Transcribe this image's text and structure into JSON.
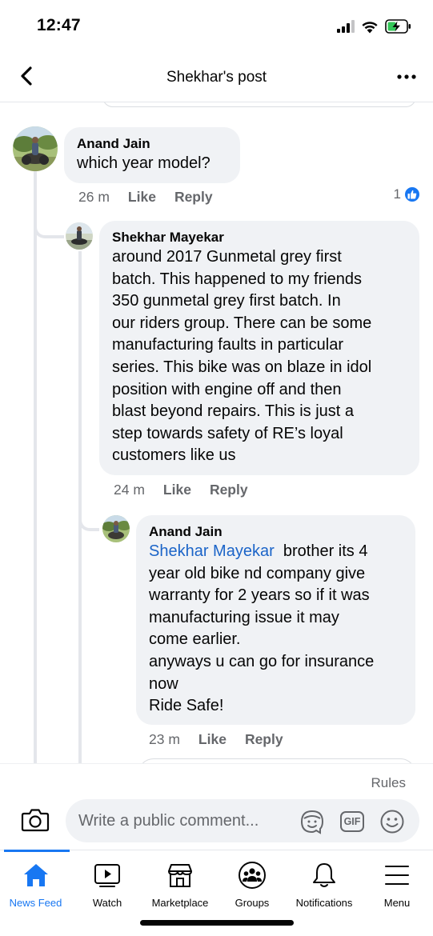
{
  "status": {
    "time": "12:47"
  },
  "header": {
    "title": "Shekhar's post"
  },
  "comments": [
    {
      "author": "Anand Jain",
      "text": "which year model?",
      "time": "26 m",
      "like_label": "Like",
      "reply_label": "Reply",
      "reactions": "1"
    },
    {
      "author": "Shekhar Mayekar",
      "text": "around 2017 Gunmetal grey first\nbatch. This happened to my friends\n350 gunmetal grey first batch. In\nour riders group. There can be some\nmanufacturing faults in particular\nseries. This bike was on blaze in idol\nposition with engine off and then\nblast beyond repairs. This is just a\nstep towards safety of RE’s loyal\ncustomers like us",
      "time": "24 m",
      "like_label": "Like",
      "reply_label": "Reply"
    },
    {
      "author": "Anand Jain",
      "mention": "Shekhar Mayekar",
      "text": "brother its 4\nyear old bike nd company give\nwarranty for 2 years so if it was\nmanufacturing issue it may\ncome earlier.\nanyways u can go for insurance\nnow\nRide Safe!",
      "time": "23 m",
      "like_label": "Like",
      "reply_label": "Reply"
    }
  ],
  "composer": {
    "rules_label": "Rules",
    "placeholder": "Write a public comment..."
  },
  "tabs": [
    {
      "label": "News Feed",
      "icon": "home-icon",
      "active": true
    },
    {
      "label": "Watch",
      "icon": "watch-icon"
    },
    {
      "label": "Marketplace",
      "icon": "marketplace-icon"
    },
    {
      "label": "Groups",
      "icon": "groups-icon"
    },
    {
      "label": "Notifications",
      "icon": "bell-icon"
    },
    {
      "label": "Menu",
      "icon": "menu-icon"
    }
  ],
  "colors": {
    "accent": "#1877f2",
    "bubble": "#f0f2f5",
    "secondary_text": "#65676b",
    "mention": "#1b64c8"
  }
}
